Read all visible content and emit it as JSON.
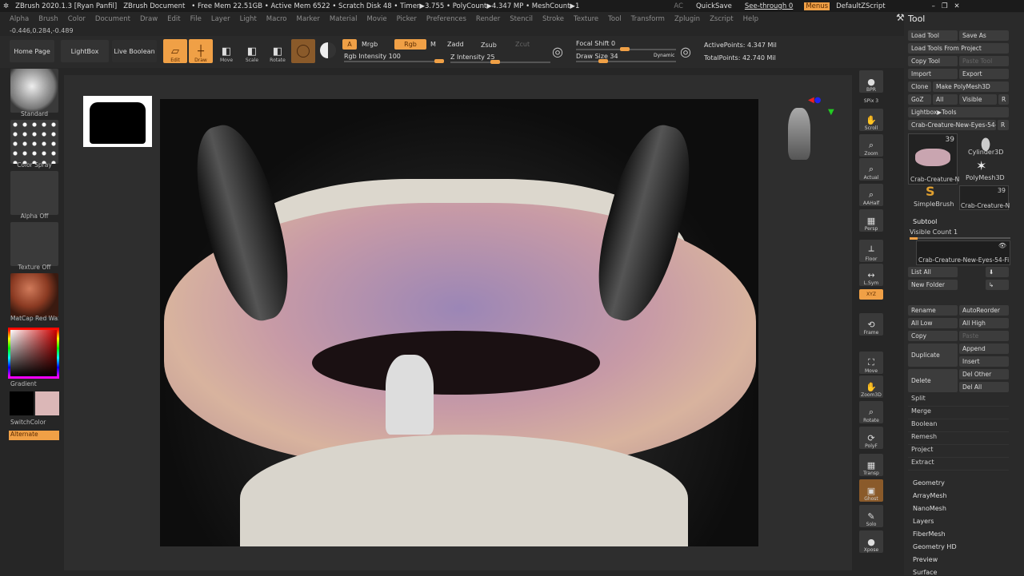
{
  "titlebar": {
    "app": "ZBrush 2020.1.3 [Ryan Panfil]",
    "doc": "ZBrush Document",
    "stats": "• Free Mem 22.51GB • Active Mem 6522 • Scratch Disk 48 • Timer▶3.755 • PolyCount▶4.347 MP • MeshCount▶1",
    "ac": "AC",
    "quicksave": "QuickSave",
    "seethrough": "See-through  0",
    "seethrough_value": 0,
    "menus": "Menus",
    "script": "DefaultZScript"
  },
  "menus": [
    "Alpha",
    "Brush",
    "Color",
    "Document",
    "Draw",
    "Edit",
    "File",
    "Layer",
    "Light",
    "Macro",
    "Marker",
    "Material",
    "Movie",
    "Picker",
    "Preferences",
    "Render",
    "Stencil",
    "Stroke",
    "Texture",
    "Tool",
    "Transform",
    "Zplugin",
    "Zscript",
    "Help"
  ],
  "coords": "-0.446,0.284,-0.489",
  "toolbar": {
    "home": "Home Page",
    "lightbox": "LightBox",
    "liveboolean": "Live Boolean",
    "edit": "Edit",
    "draw": "Draw",
    "move": "Move",
    "scale": "Scale",
    "rotate": "Rotate",
    "a": "A",
    "mrgb": "Mrgb",
    "rgb": "Rgb",
    "m": "M",
    "zadd": "Zadd",
    "zsub": "Zsub",
    "zcut": "Zcut",
    "rgb_intensity": "Rgb Intensity 100",
    "rgb_intensity_value": 100,
    "z_intensity": "Z Intensity 25",
    "z_intensity_value": 25,
    "focal_shift": "Focal Shift 0",
    "draw_size": "Draw Size 34",
    "dynamic": "Dynamic",
    "active_points": "ActivePoints: 4.347 Mil",
    "total_points": "TotalPoints: 42.740 Mil"
  },
  "left": {
    "brush": "Standard",
    "stroke": "Color Spray",
    "alpha": "Alpha Off",
    "texture": "Texture Off",
    "material": "MatCap Red Wax",
    "gradient": "Gradient",
    "switch": "SwitchColor",
    "alternate": "Alternate"
  },
  "rightshelf": [
    {
      "label": "BPR"
    },
    {
      "label": "SPix 3"
    },
    {
      "label": "Scroll"
    },
    {
      "label": "Zoom"
    },
    {
      "label": "Actual"
    },
    {
      "label": "AAHalf"
    },
    {
      "label": "Persp"
    },
    {
      "label": "Floor"
    },
    {
      "label": "L.Sym"
    },
    {
      "label": "XYZ"
    },
    {
      "label": "Frame"
    },
    {
      "label": "Move"
    },
    {
      "label": "Zoom3D"
    },
    {
      "label": "Rotate"
    },
    {
      "label": "PolyF"
    },
    {
      "label": "Transp"
    },
    {
      "label": "Ghost"
    },
    {
      "label": "Solo"
    },
    {
      "label": "Xpose"
    }
  ],
  "tool": {
    "title": "Tool",
    "load": "Load Tool",
    "saveas": "Save As",
    "loadproj": "Load Tools From Project",
    "copy": "Copy Tool",
    "paste": "Paste Tool",
    "import": "Import",
    "export": "Export",
    "clone": "Clone",
    "makepoly": "Make PolyMesh3D",
    "goz": "GoZ",
    "all": "All",
    "visible": "Visible",
    "r": "R",
    "lightbox": "Lightbox▶Tools",
    "current": "Crab-Creature-New-Eyes-54-",
    "thumbs": [
      {
        "name": "Crab-Creature-N",
        "count": "39"
      },
      {
        "name": "Cylinder3D"
      },
      {
        "name": "PolyMesh3D"
      },
      {
        "name": "SimpleBrush"
      },
      {
        "name": "Crab-Creature-N",
        "count": "39"
      }
    ],
    "subtool": "Subtool",
    "visible_count": "Visible Count 1",
    "subtool_name": "Crab-Creature-New-Eyes-54-Fi",
    "listall": "List All",
    "newfolder": "New Folder",
    "rename": "Rename",
    "autoreorder": "AutoReorder",
    "alllow": "All Low",
    "allhigh": "All High",
    "copy2": "Copy",
    "paste2": "Paste",
    "duplicate": "Duplicate",
    "append": "Append",
    "insert": "Insert",
    "delete": "Delete",
    "delother": "Del Other",
    "delall": "Del All",
    "sections": [
      "Split",
      "Merge",
      "Boolean",
      "Remesh",
      "Project",
      "Extract"
    ],
    "sections2": [
      "Geometry",
      "ArrayMesh",
      "NanoMesh",
      "Layers",
      "FiberMesh",
      "Geometry HD",
      "Preview",
      "Surface"
    ]
  },
  "colors": {
    "accent": "#f0a046"
  }
}
